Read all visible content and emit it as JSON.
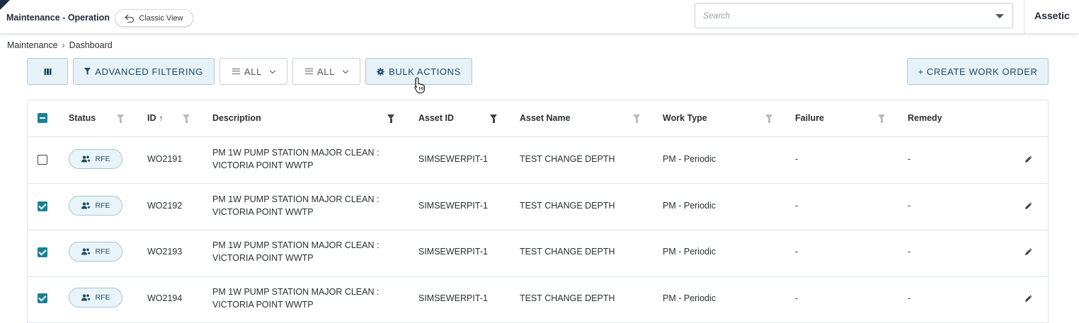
{
  "header": {
    "app_title": "Maintenance - Operation",
    "classic_view_label": "Classic View",
    "search_placeholder": "Search",
    "brand": "Assetic"
  },
  "breadcrumb": [
    "Maintenance",
    "Dashboard"
  ],
  "toolbar": {
    "advanced_filtering": "ADVANCED FILTERING",
    "filter_1": "ALL",
    "filter_2": "ALL",
    "bulk_actions": "BULK ACTIONS",
    "create_work_order": "+ CREATE WORK ORDER"
  },
  "table": {
    "columns": [
      "Status",
      "ID",
      "Description",
      "Asset ID",
      "Asset Name",
      "Work Type",
      "Failure",
      "Remedy"
    ],
    "sort_indicator": "↑",
    "rows": [
      {
        "checked": false,
        "status": "RFE",
        "id": "WO2191",
        "desc_line1": "PM 1W PUMP STATION MAJOR CLEAN :",
        "desc_line2": "VICTORIA POINT WWTP",
        "asset_id": "SIMSEWERPIT-1",
        "asset_name": "TEST CHANGE DEPTH",
        "work_type": "PM - Periodic",
        "failure": "-",
        "remedy": "-"
      },
      {
        "checked": true,
        "status": "RFE",
        "id": "WO2192",
        "desc_line1": "PM 1W PUMP STATION MAJOR CLEAN :",
        "desc_line2": "VICTORIA POINT WWTP",
        "asset_id": "SIMSEWERPIT-1",
        "asset_name": "TEST CHANGE DEPTH",
        "work_type": "PM - Periodic",
        "failure": "-",
        "remedy": "-"
      },
      {
        "checked": true,
        "status": "RFE",
        "id": "WO2193",
        "desc_line1": "PM 1W PUMP STATION MAJOR CLEAN :",
        "desc_line2": "VICTORIA POINT WWTP",
        "asset_id": "SIMSEWERPIT-1",
        "asset_name": "TEST CHANGE DEPTH",
        "work_type": "PM - Periodic",
        "failure": "-",
        "remedy": "-"
      },
      {
        "checked": true,
        "status": "RFE",
        "id": "WO2194",
        "desc_line1": "PM 1W PUMP STATION MAJOR CLEAN :",
        "desc_line2": "VICTORIA POINT WWTP",
        "asset_id": "SIMSEWERPIT-1",
        "asset_name": "TEST CHANGE DEPTH",
        "work_type": "PM - Periodic",
        "failure": "-",
        "remedy": "-"
      }
    ]
  },
  "colors": {
    "accent": "#1b7f95",
    "button_bg": "#e6f2f8",
    "header_dark": "#1c2b44"
  },
  "icons": [
    "undo-icon",
    "map-icon",
    "funnel-icon",
    "menu-lines-icon",
    "chevron-down-icon",
    "gear-icon",
    "people-icon",
    "pencil-icon",
    "sort-up-icon",
    "pointer-cursor-icon"
  ]
}
